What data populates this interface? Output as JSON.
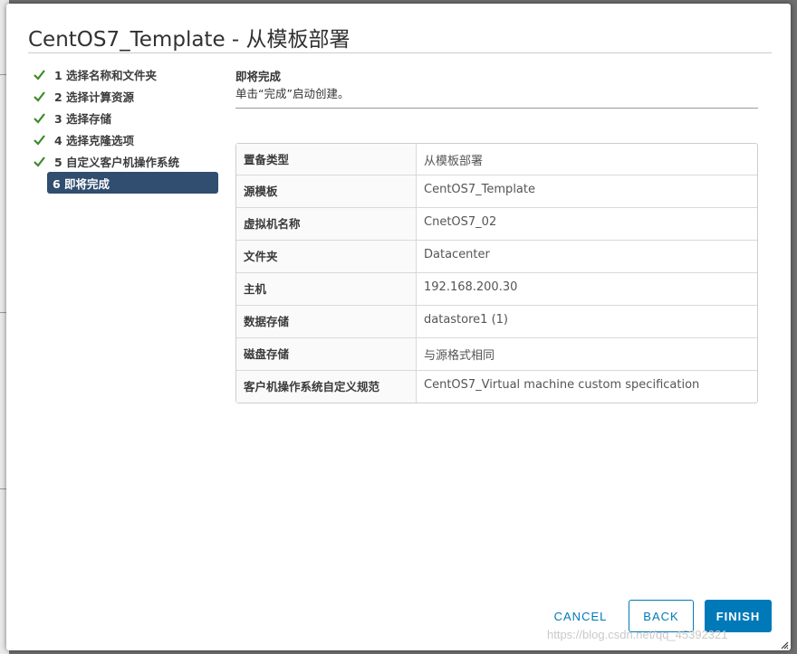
{
  "dialog": {
    "title": "CentOS7_Template - 从模板部署"
  },
  "steps": [
    {
      "label": "1 选择名称和文件夹",
      "status": "complete"
    },
    {
      "label": "2 选择计算资源",
      "status": "complete"
    },
    {
      "label": "3 选择存储",
      "status": "complete"
    },
    {
      "label": "4 选择克隆选项",
      "status": "complete"
    },
    {
      "label": "5 自定义客户机操作系统",
      "status": "complete"
    },
    {
      "label": "6 即将完成",
      "status": "current"
    }
  ],
  "content": {
    "heading": "即将完成",
    "subheading": "单击“完成”启动创建。"
  },
  "summary": [
    {
      "label": "置备类型",
      "value": "从模板部署"
    },
    {
      "label": "源模板",
      "value": "CentOS7_Template"
    },
    {
      "label": "虚拟机名称",
      "value": "CnetOS7_02"
    },
    {
      "label": "文件夹",
      "value": "Datacenter"
    },
    {
      "label": "主机",
      "value": "192.168.200.30"
    },
    {
      "label": "数据存储",
      "value": "datastore1 (1)"
    },
    {
      "label": "磁盘存储",
      "value": "与源格式相同"
    },
    {
      "label": "客户机操作系统自定义规范",
      "value": "CentOS7_Virtual machine custom specification"
    }
  ],
  "buttons": {
    "cancel": "CANCEL",
    "back": "BACK",
    "finish": "FINISH"
  },
  "watermark": "https://blog.csdn.net/qq_45392321",
  "colors": {
    "accent": "#0079b8",
    "current_step": "#314d6f",
    "check": "#3d8a2a"
  }
}
